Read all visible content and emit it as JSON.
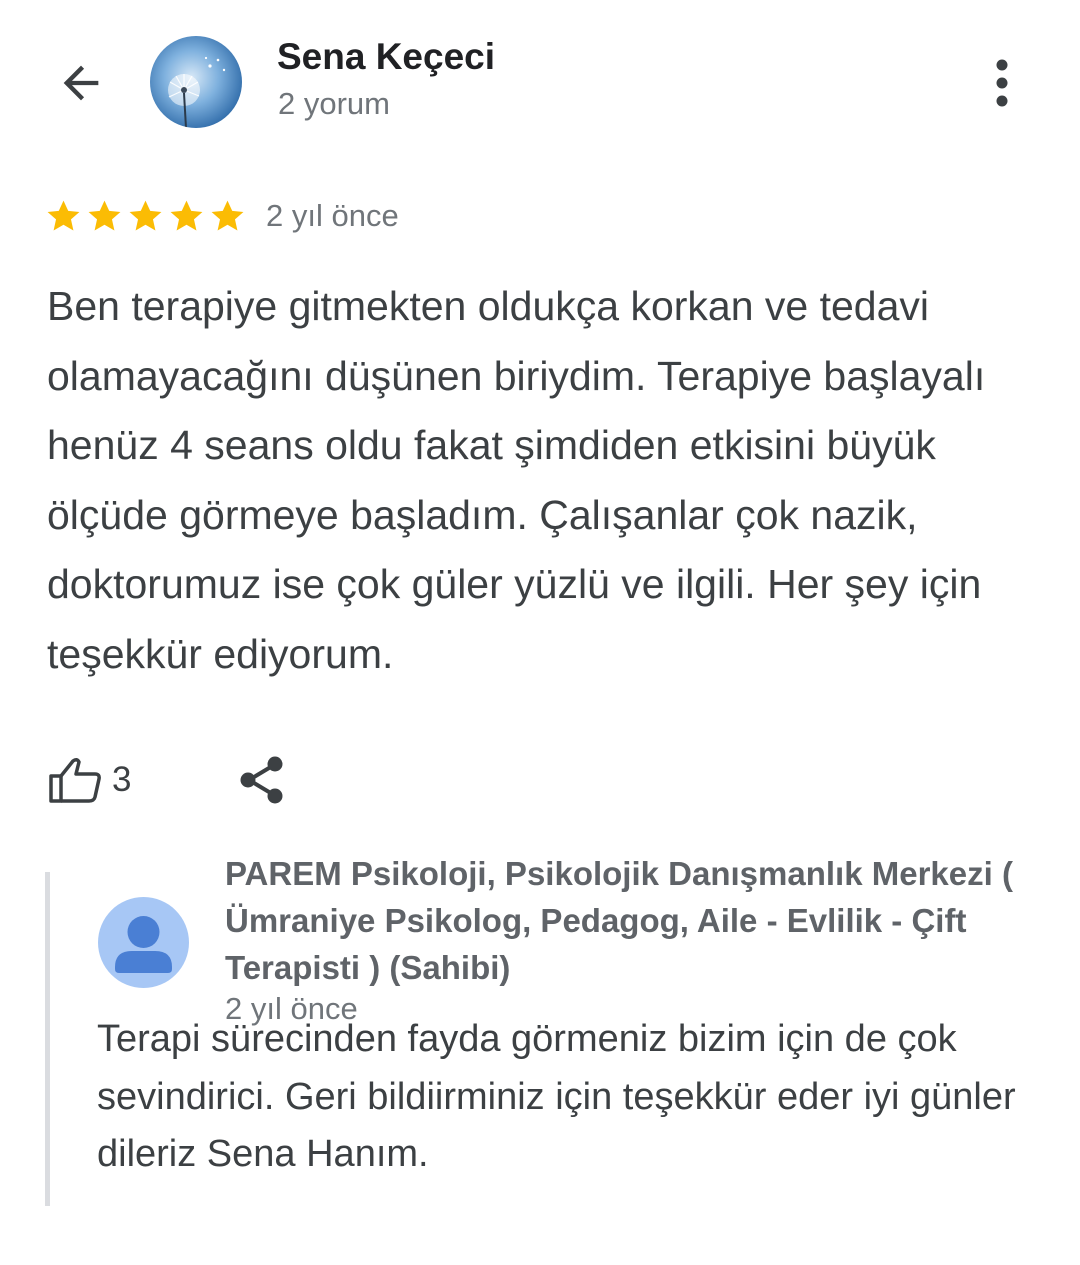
{
  "header": {
    "reviewer_name": "Sena Keçeci",
    "review_count": "2 yorum",
    "back_icon": "arrow-back-icon",
    "more_icon": "more-vert-icon"
  },
  "review": {
    "rating": 5,
    "max_rating": 5,
    "date": "2 yıl önce",
    "text": "Ben terapiye gitmekten oldukça korkan ve tedavi olamayacağını düşünen biriydim. Terapiye başlayalı henüz 4 seans oldu fakat şimdiden etkisini büyük ölçüde görmeye başladım. Çalışanlar çok nazik, doktorumuz ise çok güler yüzlü ve ilgili. Her şey için teşekkür ediyorum.",
    "star_color": "#fbbc04"
  },
  "actions": {
    "like_count": "3",
    "like_icon": "thumb-up-icon",
    "share_icon": "share-icon"
  },
  "owner_reply": {
    "name": "PAREM Psikoloji, Psikolojik Danışmanlık Merkezi ( Ümraniye Psikolog, Pedagog, Aile - Evlilik - Çift Terapisti ) (Sahibi)",
    "date": "2 yıl önce",
    "text": "Terapi sürecinden fayda görmeniz bizim için de çok sevindirici. Geri bildiirminiz için teşekkür eder iyi günler dileriz Sena Hanım.",
    "avatar_icon": "person-icon",
    "avatar_color": "#a7c7f5"
  }
}
